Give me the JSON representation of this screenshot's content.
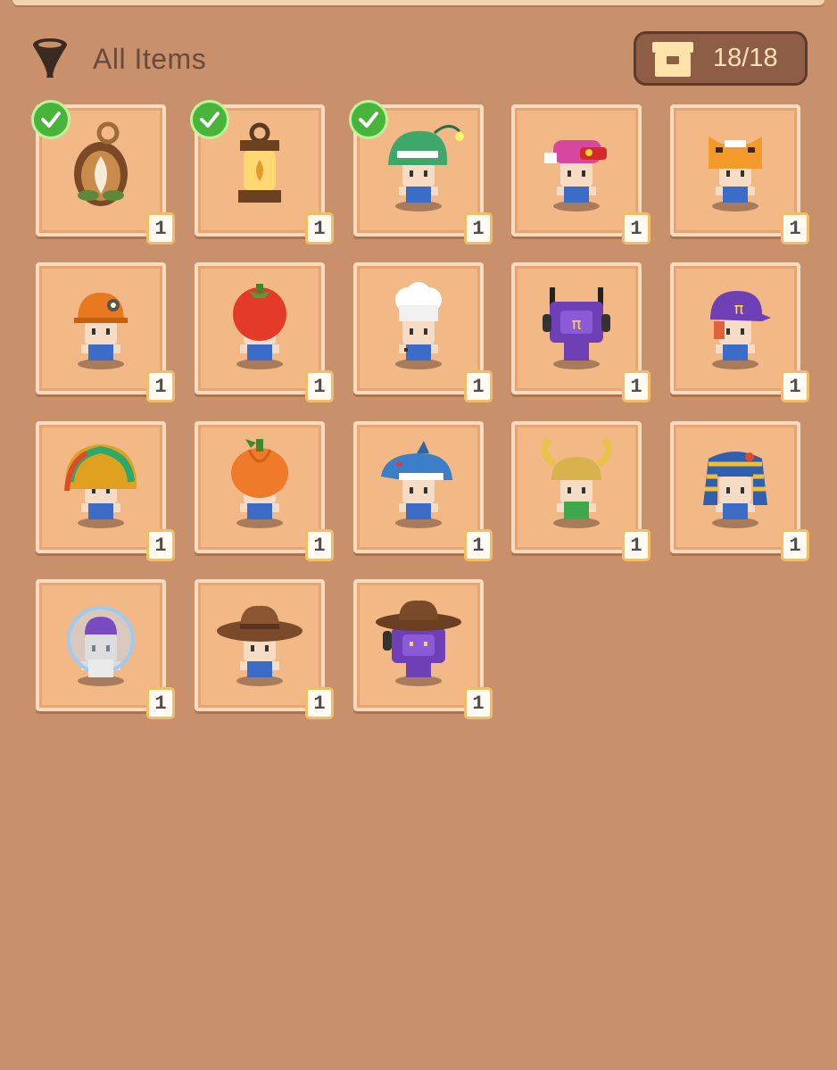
{
  "header": {
    "filter_icon": "funnel-icon",
    "filter_label": "All Items",
    "capacity_icon": "storage-box-icon",
    "capacity": "18/18"
  },
  "colors": {
    "background": "#c8916b",
    "slot": "#f2b886",
    "slot_border": "#f9dcbd",
    "check_badge": "#48b53a",
    "capacity_badge": "#8e5d45"
  },
  "items": [
    {
      "icon": "seed-pendant-icon",
      "count": "1",
      "equipped": true
    },
    {
      "icon": "lantern-icon",
      "count": "1",
      "equipped": true
    },
    {
      "icon": "anglerfish-hat-avatar-icon",
      "count": "1",
      "equipped": true
    },
    {
      "icon": "pink-cap-avatar-icon",
      "count": "1",
      "equipped": false
    },
    {
      "icon": "tiger-hood-avatar-icon",
      "count": "1",
      "equipped": false
    },
    {
      "icon": "miner-helmet-avatar-icon",
      "count": "1",
      "equipped": false
    },
    {
      "icon": "tomato-hat-avatar-icon",
      "count": "1",
      "equipped": false
    },
    {
      "icon": "chef-hat-avatar-icon",
      "count": "1",
      "equipped": false
    },
    {
      "icon": "robot-head-avatar-icon",
      "count": "1",
      "equipped": false
    },
    {
      "icon": "purple-pi-cap-avatar-icon",
      "count": "1",
      "equipped": false
    },
    {
      "icon": "feather-headdress-avatar-icon",
      "count": "1",
      "equipped": false
    },
    {
      "icon": "pumpkin-hat-avatar-icon",
      "count": "1",
      "equipped": false
    },
    {
      "icon": "shark-hood-avatar-icon",
      "count": "1",
      "equipped": false
    },
    {
      "icon": "horned-helmet-avatar-icon",
      "count": "1",
      "equipped": false
    },
    {
      "icon": "pharaoh-headdress-avatar-icon",
      "count": "1",
      "equipped": false
    },
    {
      "icon": "astronaut-helmet-avatar-icon",
      "count": "1",
      "equipped": false
    },
    {
      "icon": "cowboy-hat-avatar-icon",
      "count": "1",
      "equipped": false
    },
    {
      "icon": "robot-cowboy-avatar-icon",
      "count": "1",
      "equipped": false
    }
  ]
}
